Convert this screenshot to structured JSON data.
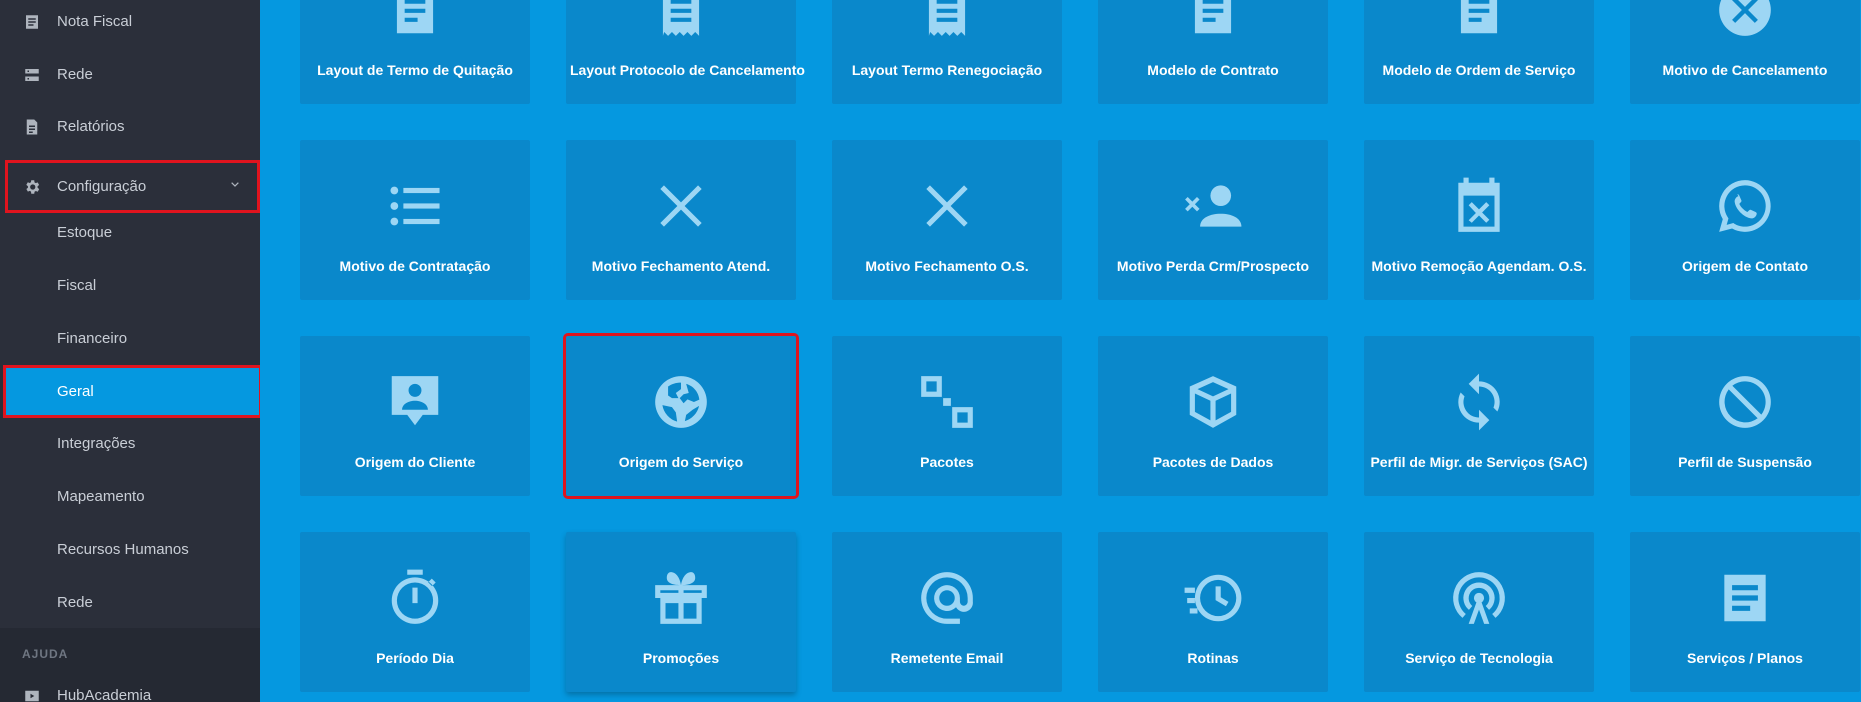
{
  "sidebar": {
    "items": [
      {
        "label": "Nota Fiscal",
        "icon": "receipt-icon"
      },
      {
        "label": "Rede",
        "icon": "server-icon"
      },
      {
        "label": "Relatórios",
        "icon": "document-icon"
      },
      {
        "label": "Configuração",
        "icon": "gear-icon",
        "expanded": true,
        "highlighted": true
      }
    ],
    "subitems": [
      {
        "label": "Estoque"
      },
      {
        "label": "Fiscal"
      },
      {
        "label": "Financeiro"
      },
      {
        "label": "Geral",
        "active": true,
        "highlighted": true
      },
      {
        "label": "Integrações"
      },
      {
        "label": "Mapeamento"
      },
      {
        "label": "Recursos Humanos"
      },
      {
        "label": "Rede"
      }
    ],
    "section_label": "AJUDA",
    "help_item": {
      "label": "HubAcademia",
      "icon": "play-icon"
    }
  },
  "tiles": [
    {
      "label": "Layout de Termo de Quitação",
      "icon": "document-icon"
    },
    {
      "label": "Layout Protocolo de Cancelamento",
      "icon": "receipt-icon"
    },
    {
      "label": "Layout Termo Renegociação",
      "icon": "receipt-icon"
    },
    {
      "label": "Modelo de Contrato",
      "icon": "document-icon"
    },
    {
      "label": "Modelo de Ordem de Serviço",
      "icon": "document-icon"
    },
    {
      "label": "Motivo de Cancelamento",
      "icon": "cancel-circle-icon"
    },
    {
      "label": "Motivo de Contratação",
      "icon": "list-icon"
    },
    {
      "label": "Motivo Fechamento Atend.",
      "icon": "close-icon"
    },
    {
      "label": "Motivo Fechamento O.S.",
      "icon": "close-icon"
    },
    {
      "label": "Motivo Perda Crm/Prospecto",
      "icon": "person-remove-icon"
    },
    {
      "label": "Motivo Remoção Agendam. O.S.",
      "icon": "calendar-remove-icon"
    },
    {
      "label": "Origem de Contato",
      "icon": "whatsapp-icon"
    },
    {
      "label": "Origem do Cliente",
      "icon": "person-message-icon"
    },
    {
      "label": "Origem do Serviço",
      "icon": "globe-icon",
      "highlighted": true
    },
    {
      "label": "Pacotes",
      "icon": "squares-icon"
    },
    {
      "label": "Pacotes de Dados",
      "icon": "package-icon"
    },
    {
      "label": "Perfil de Migr. de Serviços (SAC)",
      "icon": "sync-icon"
    },
    {
      "label": "Perfil de Suspensão",
      "icon": "block-icon"
    },
    {
      "label": "Período Dia",
      "icon": "timer-icon"
    },
    {
      "label": "Promoções",
      "icon": "gift-icon"
    },
    {
      "label": "Remetente Email",
      "icon": "at-icon"
    },
    {
      "label": "Rotinas",
      "icon": "history-icon"
    },
    {
      "label": "Serviço de Tecnologia",
      "icon": "antenna-icon"
    },
    {
      "label": "Serviços / Planos",
      "icon": "document-icon"
    }
  ],
  "colors": {
    "sidebar_bg": "#2b2f3a",
    "main_bg": "#0598e0",
    "tile_bg": "#0a88cb",
    "icon": "#9dd6f4",
    "highlight": "#e0141e"
  }
}
